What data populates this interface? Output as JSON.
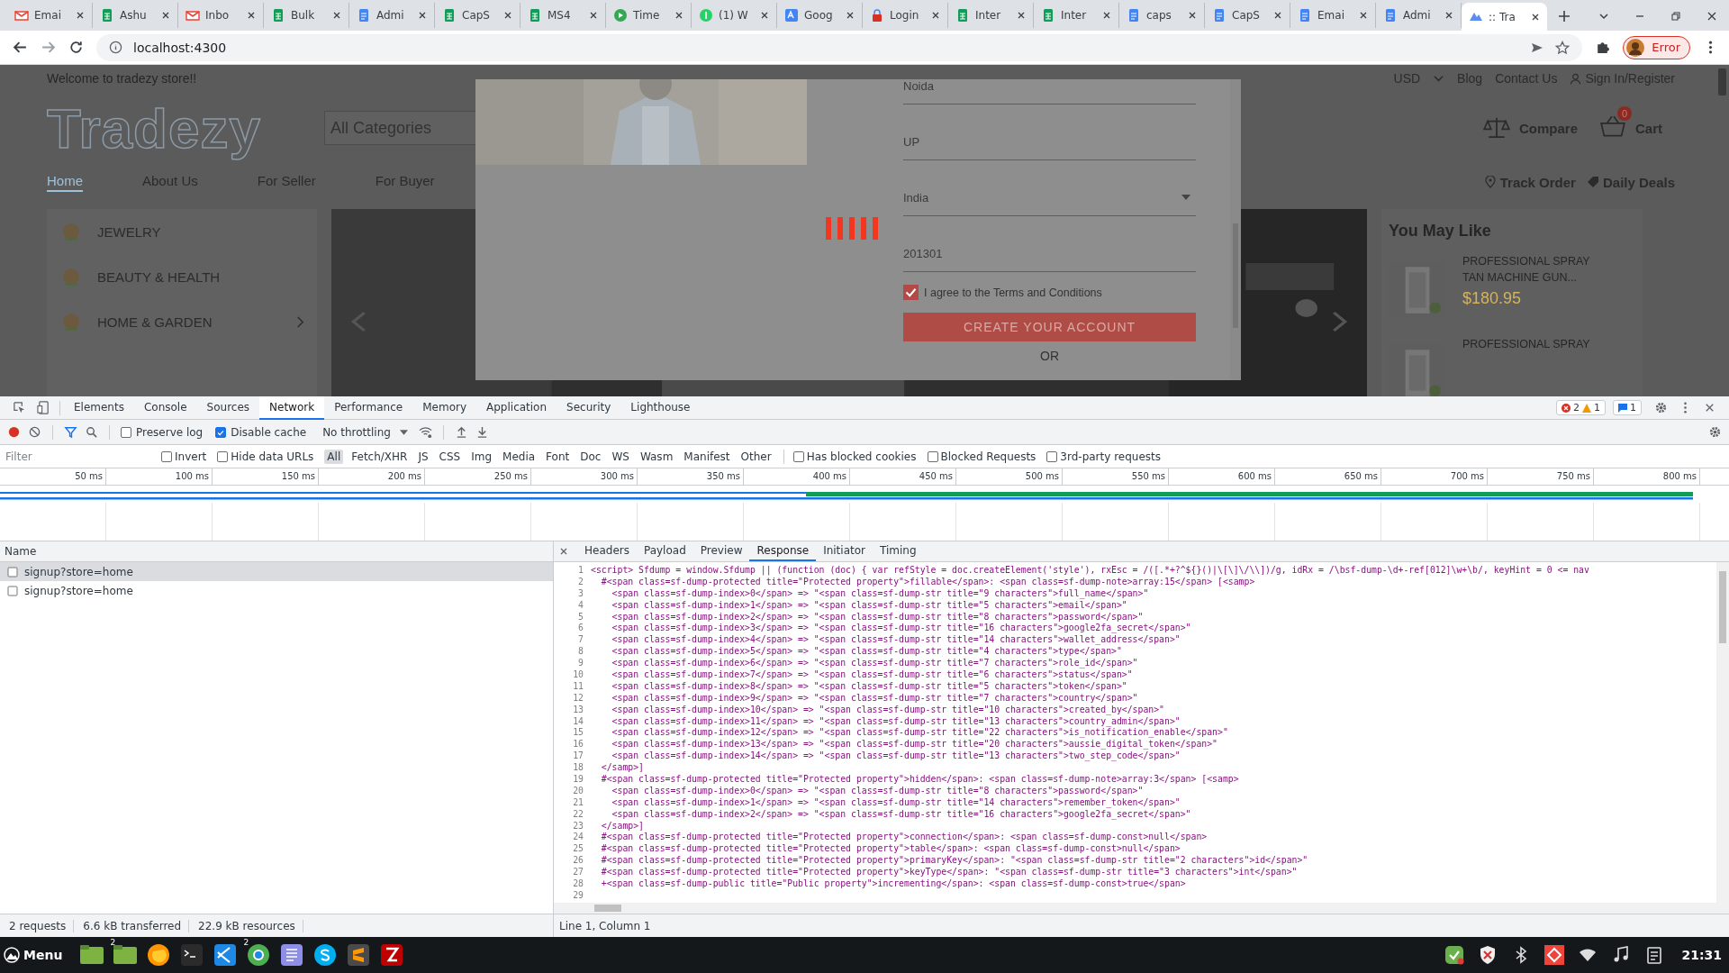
{
  "browser": {
    "tabs": [
      {
        "title": "Emai",
        "kind": "gmail",
        "selected": false
      },
      {
        "title": "Ashu",
        "kind": "sheets",
        "selected": false
      },
      {
        "title": "Inbo",
        "kind": "gmail",
        "selected": false
      },
      {
        "title": "Bulk",
        "kind": "sheets",
        "selected": false
      },
      {
        "title": "Admi",
        "kind": "docs",
        "selected": false
      },
      {
        "title": "CapS",
        "kind": "sheets",
        "selected": false
      },
      {
        "title": "MS4",
        "kind": "sheets",
        "selected": false
      },
      {
        "title": "Time",
        "kind": "play",
        "selected": false
      },
      {
        "title": "(1) W",
        "kind": "chat",
        "selected": false
      },
      {
        "title": "Goog",
        "kind": "translate",
        "selected": false
      },
      {
        "title": "Login",
        "kind": "lock",
        "selected": false
      },
      {
        "title": "Inter",
        "kind": "sheets",
        "selected": false
      },
      {
        "title": "Inter",
        "kind": "sheets",
        "selected": false
      },
      {
        "title": "caps",
        "kind": "docs",
        "selected": false
      },
      {
        "title": "CapS",
        "kind": "docs",
        "selected": false
      },
      {
        "title": "Emai",
        "kind": "docs",
        "selected": false
      },
      {
        "title": "Admi",
        "kind": "docs",
        "selected": false
      },
      {
        "title": ":: Tra",
        "kind": "app",
        "selected": true
      }
    ],
    "address": "localhost:4300",
    "profile_button": "Error"
  },
  "site": {
    "welcome": "Welcome to tradezy store!!",
    "currency": "USD",
    "top_links": [
      "Blog",
      "Contact Us"
    ],
    "sign_in": "Sign In/Register",
    "logo": "Tradezy",
    "category_select": "All Categories",
    "compare": "Compare",
    "cart_count": "0",
    "cart": "Cart",
    "nav": [
      {
        "label": "Home",
        "selected": true
      },
      {
        "label": "About Us",
        "selected": false
      },
      {
        "label": "For Seller",
        "selected": false
      },
      {
        "label": "For Buyer",
        "selected": false
      }
    ],
    "track_order": "Track Order",
    "daily_deals": "Daily Deals",
    "categories": [
      {
        "label": "JEWELRY",
        "has_children": false
      },
      {
        "label": "BEAUTY & HEALTH",
        "has_children": false
      },
      {
        "label": "HOME & GARDEN",
        "has_children": true
      }
    ],
    "you_may_like": {
      "title": "You May Like",
      "products": [
        {
          "name": "PROFESSIONAL SPRAY TAN MACHINE GUN...",
          "price": "$180.95"
        },
        {
          "name": "PROFESSIONAL SPRAY"
        }
      ]
    }
  },
  "modal": {
    "fields": [
      {
        "kind": "text",
        "value": "Noida"
      },
      {
        "kind": "text",
        "value": "UP"
      },
      {
        "kind": "select",
        "value": "India"
      },
      {
        "kind": "text",
        "value": "201301"
      }
    ],
    "terms": {
      "label": "I agree to the Terms and Conditions",
      "checked": true
    },
    "submit": "CREATE YOUR ACCOUNT",
    "or": "OR",
    "loading": true
  },
  "devtools": {
    "panels": [
      {
        "label": "Elements",
        "selected": false
      },
      {
        "label": "Console",
        "selected": false
      },
      {
        "label": "Sources",
        "selected": false
      },
      {
        "label": "Network",
        "selected": true
      },
      {
        "label": "Performance",
        "selected": false
      },
      {
        "label": "Memory",
        "selected": false
      },
      {
        "label": "Application",
        "selected": false
      },
      {
        "label": "Security",
        "selected": false
      },
      {
        "label": "Lighthouse",
        "selected": false
      }
    ],
    "errors": "2",
    "warnings": "1",
    "messages": "1",
    "preserve_log": {
      "label": "Preserve log",
      "checked": false
    },
    "disable_cache": {
      "label": "Disable cache",
      "checked": true
    },
    "throttling": "No throttling",
    "filter_placeholder": "Filter",
    "filter_checks": [
      {
        "label": "Invert",
        "checked": false
      },
      {
        "label": "Hide data URLs",
        "checked": false
      }
    ],
    "types": [
      {
        "label": "All",
        "selected": true
      },
      {
        "label": "Fetch/XHR",
        "selected": false
      },
      {
        "label": "JS",
        "selected": false
      },
      {
        "label": "CSS",
        "selected": false
      },
      {
        "label": "Img",
        "selected": false
      },
      {
        "label": "Media",
        "selected": false
      },
      {
        "label": "Font",
        "selected": false
      },
      {
        "label": "Doc",
        "selected": false
      },
      {
        "label": "WS",
        "selected": false
      },
      {
        "label": "Wasm",
        "selected": false
      },
      {
        "label": "Manifest",
        "selected": false
      },
      {
        "label": "Other",
        "selected": false
      }
    ],
    "more_checks": [
      {
        "label": "Has blocked cookies",
        "checked": false
      },
      {
        "label": "Blocked Requests",
        "checked": false
      },
      {
        "label": "3rd-party requests",
        "checked": false
      }
    ],
    "ticks": [
      "50 ms",
      "100 ms",
      "150 ms",
      "200 ms",
      "250 ms",
      "300 ms",
      "350 ms",
      "400 ms",
      "450 ms",
      "500 ms",
      "550 ms",
      "600 ms",
      "650 ms",
      "700 ms",
      "750 ms",
      "800 ms"
    ],
    "name_column": "Name",
    "requests": [
      {
        "name": "signup?store=home",
        "selected": true
      },
      {
        "name": "signup?store=home",
        "selected": false
      }
    ],
    "detail_tabs": [
      {
        "label": "Headers",
        "selected": false
      },
      {
        "label": "Payload",
        "selected": false
      },
      {
        "label": "Preview",
        "selected": false
      },
      {
        "label": "Response",
        "selected": true
      },
      {
        "label": "Initiator",
        "selected": false
      },
      {
        "label": "Timing",
        "selected": false
      }
    ],
    "lines": [
      {
        "number": "1",
        "text": "<script> Sfdump = window.Sfdump || (function (doc) { var refStyle = doc.createElement('style'), rxEsc = /([.*+?^${}()|\\[\\]\\/\\\\])/g, idRx = /\\bsf-dump-\\d+-ref[012]\\w+\\b/, keyHint = 0 <= nav"
      },
      {
        "number": "2",
        "text": "  #<span class=sf-dump-protected title=\"Protected property\">fillable</span>: <span class=sf-dump-note>array:15</span> [<samp>"
      },
      {
        "number": "3",
        "text": "    <span class=sf-dump-index>0</span> => \"<span class=sf-dump-str title=\"9 characters\">full_name</span>\""
      },
      {
        "number": "4",
        "text": "    <span class=sf-dump-index>1</span> => \"<span class=sf-dump-str title=\"5 characters\">email</span>\""
      },
      {
        "number": "5",
        "text": "    <span class=sf-dump-index>2</span> => \"<span class=sf-dump-str title=\"8 characters\">password</span>\""
      },
      {
        "number": "6",
        "text": "    <span class=sf-dump-index>3</span> => \"<span class=sf-dump-str title=\"16 characters\">google2fa_secret</span>\""
      },
      {
        "number": "7",
        "text": "    <span class=sf-dump-index>4</span> => \"<span class=sf-dump-str title=\"14 characters\">wallet_address</span>\""
      },
      {
        "number": "8",
        "text": "    <span class=sf-dump-index>5</span> => \"<span class=sf-dump-str title=\"4 characters\">type</span>\""
      },
      {
        "number": "9",
        "text": "    <span class=sf-dump-index>6</span> => \"<span class=sf-dump-str title=\"7 characters\">role_id</span>\""
      },
      {
        "number": "10",
        "text": "    <span class=sf-dump-index>7</span> => \"<span class=sf-dump-str title=\"6 characters\">status</span>\""
      },
      {
        "number": "11",
        "text": "    <span class=sf-dump-index>8</span> => \"<span class=sf-dump-str title=\"5 characters\">token</span>\""
      },
      {
        "number": "12",
        "text": "    <span class=sf-dump-index>9</span> => \"<span class=sf-dump-str title=\"7 characters\">country</span>\""
      },
      {
        "number": "13",
        "text": "    <span class=sf-dump-index>10</span> => \"<span class=sf-dump-str title=\"10 characters\">created_by</span>\""
      },
      {
        "number": "14",
        "text": "    <span class=sf-dump-index>11</span> => \"<span class=sf-dump-str title=\"13 characters\">country_admin</span>\""
      },
      {
        "number": "15",
        "text": "    <span class=sf-dump-index>12</span> => \"<span class=sf-dump-str title=\"22 characters\">is_notification_enable</span>\""
      },
      {
        "number": "16",
        "text": "    <span class=sf-dump-index>13</span> => \"<span class=sf-dump-str title=\"20 characters\">aussie_digital_token</span>\""
      },
      {
        "number": "17",
        "text": "    <span class=sf-dump-index>14</span> => \"<span class=sf-dump-str title=\"13 characters\">two_step_code</span>\""
      },
      {
        "number": "18",
        "text": "  </samp>]"
      },
      {
        "number": "19",
        "text": "  #<span class=sf-dump-protected title=\"Protected property\">hidden</span>: <span class=sf-dump-note>array:3</span> [<samp>"
      },
      {
        "number": "20",
        "text": "    <span class=sf-dump-index>0</span> => \"<span class=sf-dump-str title=\"8 characters\">password</span>\""
      },
      {
        "number": "21",
        "text": "    <span class=sf-dump-index>1</span> => \"<span class=sf-dump-str title=\"14 characters\">remember_token</span>\""
      },
      {
        "number": "22",
        "text": "    <span class=sf-dump-index>2</span> => \"<span class=sf-dump-str title=\"16 characters\">google2fa_secret</span>\""
      },
      {
        "number": "23",
        "text": "  </samp>]"
      },
      {
        "number": "24",
        "text": "  #<span class=sf-dump-protected title=\"Protected property\">connection</span>: <span class=sf-dump-const>null</span>"
      },
      {
        "number": "25",
        "text": "  #<span class=sf-dump-protected title=\"Protected property\">table</span>: <span class=sf-dump-const>null</span>"
      },
      {
        "number": "26",
        "text": "  #<span class=sf-dump-protected title=\"Protected property\">primaryKey</span>: \"<span class=sf-dump-str title=\"2 characters\">id</span>\""
      },
      {
        "number": "27",
        "text": "  #<span class=sf-dump-protected title=\"Protected property\">keyType</span>: \"<span class=sf-dump-str title=\"3 characters\">int</span>\""
      },
      {
        "number": "28",
        "text": "  +<span class=sf-dump-public title=\"Public property\">incrementing</span>: <span class=sf-dump-const>true</span>"
      },
      {
        "number": "29"
      }
    ],
    "cursor": "Line 1, Column 1",
    "summary": [
      "2 requests",
      "6.6 kB transferred",
      "22.9 kB resources"
    ]
  },
  "taskbar": {
    "menu": "Menu",
    "apps": [
      {
        "kind": "folder"
      },
      {
        "kind": "folder",
        "badge": "2"
      },
      {
        "kind": "firefox"
      },
      {
        "kind": "terminal"
      },
      {
        "kind": "vscode"
      },
      {
        "kind": "chrome",
        "badge": "2"
      },
      {
        "kind": "notes"
      },
      {
        "kind": "skype"
      },
      {
        "kind": "sublime"
      },
      {
        "kind": "filezilla"
      }
    ],
    "clock": "21:31"
  }
}
